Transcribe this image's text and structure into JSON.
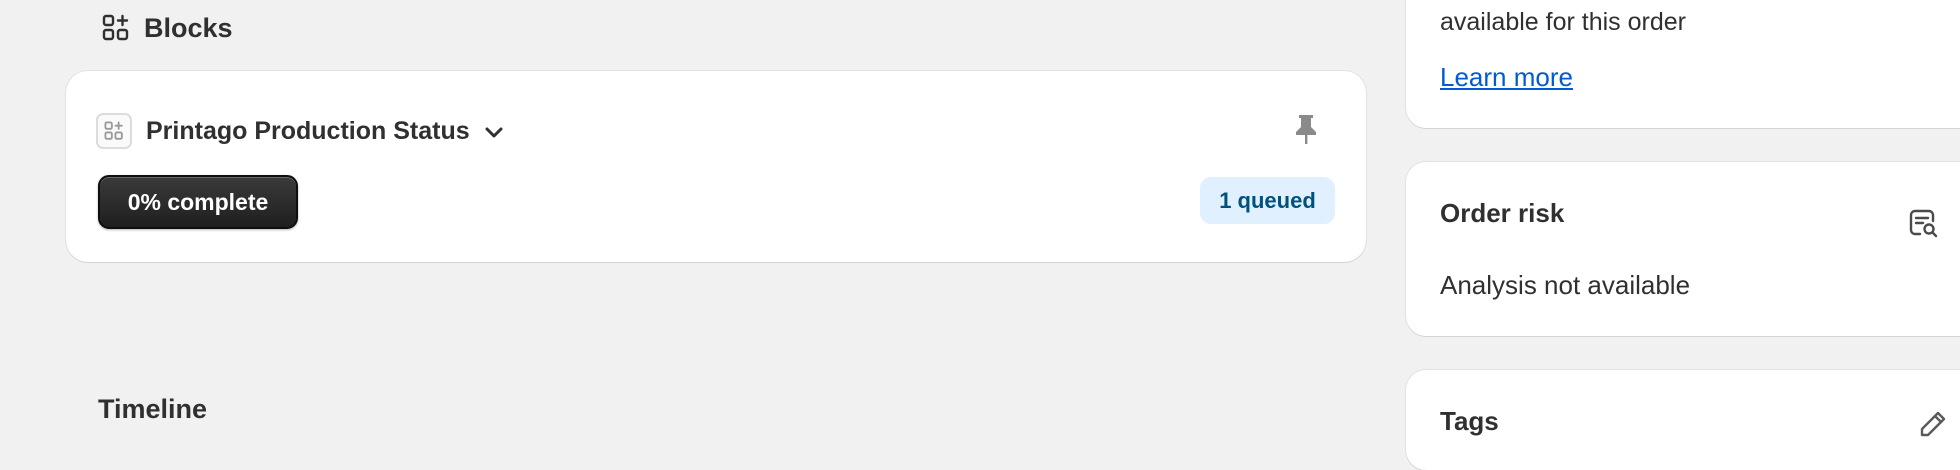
{
  "blocks": {
    "title": "Blocks",
    "icon": "blocks-icon"
  },
  "block": {
    "title": "Printago Production Status",
    "app_icon": "app-placeholder-icon",
    "pin_icon": "pin-icon",
    "progress_label": "0% complete",
    "progress_value": 0,
    "queued_badge": "1 queued"
  },
  "timeline": {
    "title": "Timeline"
  },
  "sidebar": {
    "top_card": {
      "text": "available for this order",
      "link": "Learn more"
    },
    "order_risk": {
      "title": "Order risk",
      "status": "Analysis not available",
      "icon": "risk-analysis-icon"
    },
    "tags": {
      "title": "Tags",
      "icon": "edit-pencil-icon"
    }
  },
  "colors": {
    "background": "#f1f1f1",
    "card": "#ffffff",
    "link": "#005bd3",
    "badge_bg": "#e0f0ff",
    "badge_text": "#00527c",
    "button_dark": "#303030"
  }
}
